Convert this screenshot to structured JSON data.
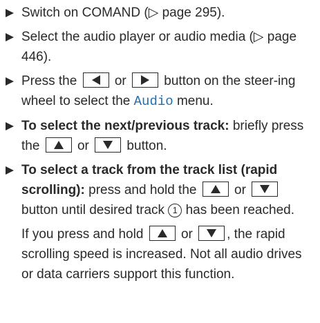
{
  "steps": {
    "s1": {
      "text": "Switch on COMAND (▷ page 295)."
    },
    "s2": {
      "text": "Select the audio player or audio media (▷ page 446)."
    },
    "s3": {
      "part1": "Press the ",
      "or": " or ",
      "part2": " button on the steer-ing wheel to select the ",
      "audio": "Audio",
      "part3": " menu."
    },
    "s4": {
      "bold": "To select the next/previous track:",
      "part1": " briefly press the ",
      "or": " or ",
      "part2": " button."
    },
    "s5": {
      "bold": "To select a track from the track list (rapid scrolling):",
      "part1": " press and hold the ",
      "or": " or ",
      "part2": " button until desired track ",
      "circle": "1",
      "part3": " has been reached."
    }
  },
  "note": {
    "part1": "If you press and hold ",
    "or": " or ",
    "part2": ", the rapid scrolling speed is increased. Not all audio drives or data carriers support this function."
  },
  "icons": {
    "bullet": "right-triangle-bullet",
    "left_button": "left-arrow-button",
    "right_button": "right-arrow-button",
    "up_button": "up-arrow-button",
    "down_button": "down-arrow-button"
  },
  "colors": {
    "text": "#2a2a2a",
    "audio_menu": "#1f6fb0"
  }
}
